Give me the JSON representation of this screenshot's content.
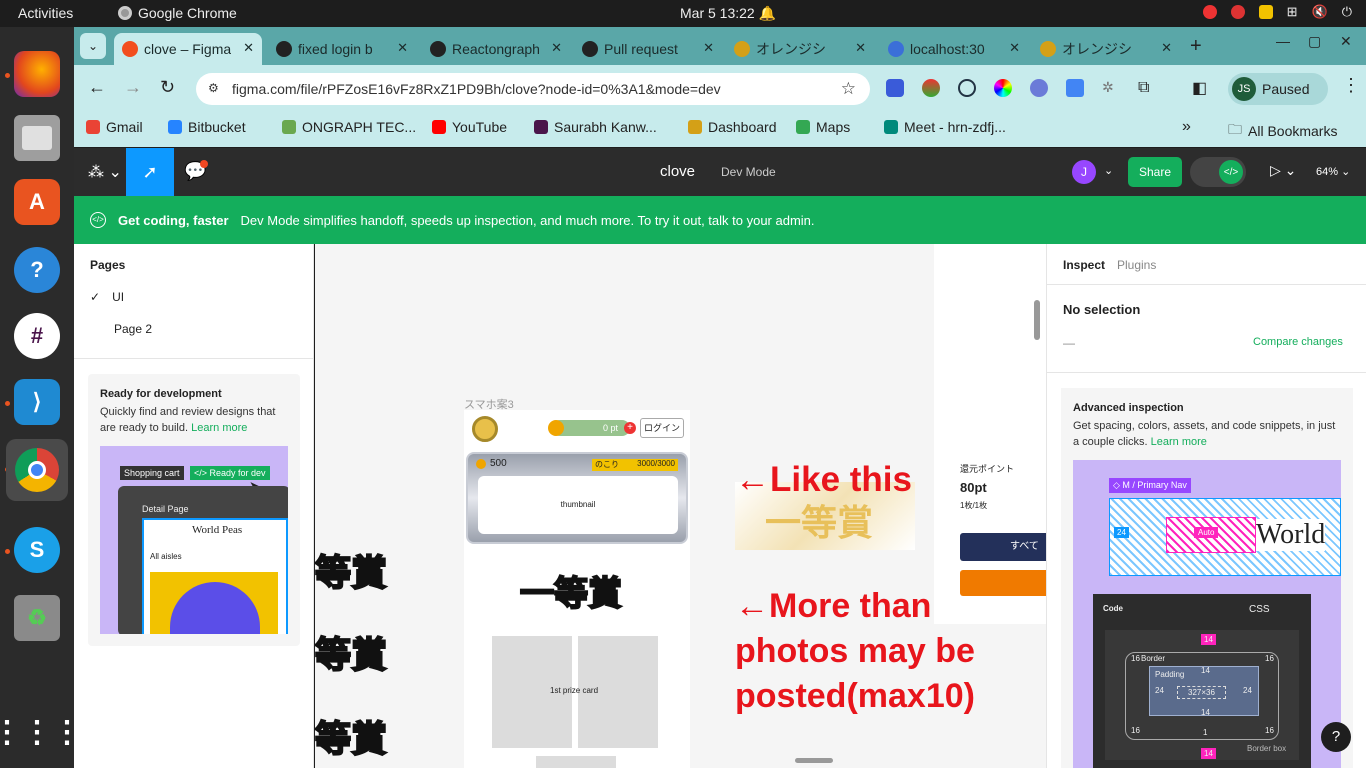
{
  "os": {
    "activities": "Activities",
    "app_name": "Google Chrome",
    "clock": "Mar 5  13:22"
  },
  "dock": {
    "items": [
      "firefox-icon",
      "files-icon",
      "app-center-icon",
      "help-icon",
      "slack-icon",
      "vscode-icon",
      "chrome-icon",
      "skype-icon",
      "trash-icon",
      "apps-grid-icon"
    ]
  },
  "tabs": [
    {
      "title": "clove – Figma",
      "color": "#f24e1e"
    },
    {
      "title": "fixed login b",
      "color": "#222"
    },
    {
      "title": "Reactongraph",
      "color": "#222"
    },
    {
      "title": "Pull request",
      "color": "#222"
    },
    {
      "title": "オレンジシ",
      "color": "#d4a017"
    },
    {
      "title": "localhost:30",
      "color": "#3b6fd8"
    },
    {
      "title": "オレンジシ",
      "color": "#d4a017"
    }
  ],
  "address": {
    "url": "figma.com/file/rPFZosE16vFz8RxZ1PD9Bh/clove?node-id=0%3A1&mode=dev",
    "profile_initials": "JS",
    "profile_status": "Paused"
  },
  "bookmarks": [
    {
      "label": "Gmail",
      "color": "#ea4335"
    },
    {
      "label": "Bitbucket",
      "color": "#2684ff"
    },
    {
      "label": "ONGRAPH TEC...",
      "color": "#6aa84f"
    },
    {
      "label": "YouTube",
      "color": "#ff0000"
    },
    {
      "label": "Saurabh Kanw...",
      "color": "#4a154b"
    },
    {
      "label": "Dashboard",
      "color": "#d4a017"
    },
    {
      "label": "Maps",
      "color": "#34a853"
    },
    {
      "label": "Meet - hrn-zdfj...",
      "color": "#00897b"
    }
  ],
  "all_bookmarks": "All Bookmarks",
  "figma": {
    "file_name": "clove",
    "mode_label": "Dev Mode",
    "user_initial": "J",
    "share_label": "Share",
    "zoom": "64%",
    "banner_strong": "Get coding, faster",
    "banner_text": "Dev Mode simplifies handoff, speeds up inspection, and much more. To try it out, talk to your admin.",
    "pages_title": "Pages",
    "pages": [
      "UI",
      "Page 2"
    ],
    "ready_title": "Ready for development",
    "ready_desc": "Quickly find and review designs that are ready to build.",
    "learn_more": "Learn more",
    "preview": {
      "shopping_cart": "Shopping cart",
      "ready_for_dev": "</> Ready for dev",
      "detail_page": "Detail Page",
      "world_peas": "World Peas",
      "all_aisles": "All aisles"
    },
    "inspect_tab": "Inspect",
    "plugins_tab": "Plugins",
    "no_selection": "No selection",
    "dash": "—",
    "compare_changes": "Compare changes",
    "adv_title": "Advanced inspection",
    "adv_desc": "Get spacing, colors, assets, and code snippets, in just a couple clicks.",
    "adv_preview": {
      "nav_label": "◇ M / Primary Nav",
      "world": "World",
      "auto": "Auto",
      "code": "Code",
      "css": "CSS",
      "border": "Border",
      "padding": "Padding",
      "size": "327×36",
      "border_box": "Border box",
      "v14": "14",
      "v16": "16",
      "v24": "24",
      "v1": "1"
    }
  },
  "canvas": {
    "frame_label": "スマホ案3",
    "points": "0 pt",
    "login": "ログイン",
    "coin_count": "500",
    "remaining_label": "のこり",
    "remaining": "3000/3000",
    "thumbnail": "thumbnail",
    "prize_card": "1st prize card",
    "medal_text": "一等賞",
    "medal_left": "等賞",
    "note1": "←Like this",
    "note2_line1": "←More than",
    "note2_line2": "photos may be",
    "note2_line3": "posted(max10)",
    "right_card_label": "還元ポイント",
    "right_card_value": "80pt",
    "right_card_sub": "1枚/1枚",
    "right_card_btn": "すべて"
  }
}
